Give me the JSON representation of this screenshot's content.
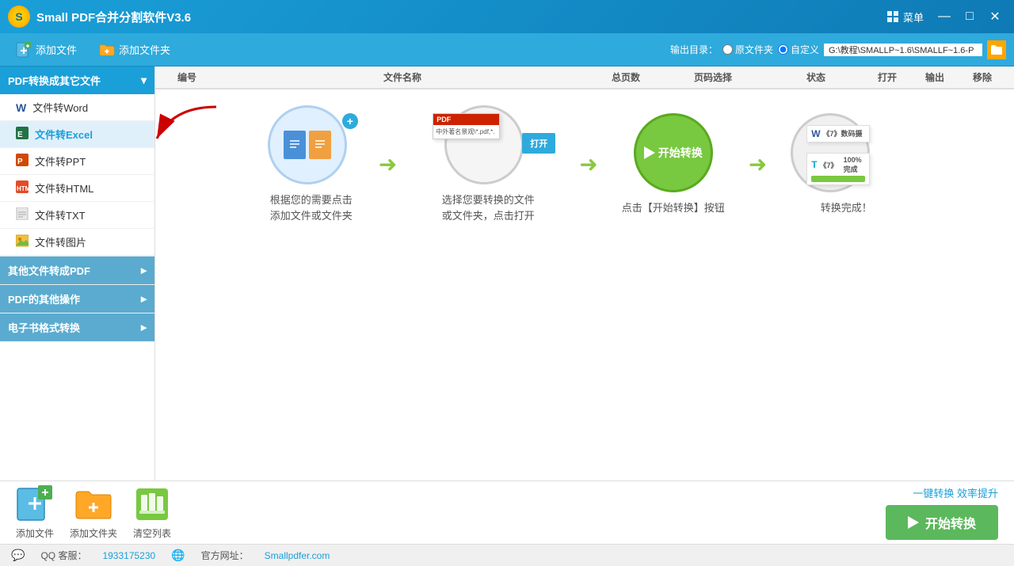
{
  "titleBar": {
    "logoText": "S",
    "title": "Small PDF合并分割软件V3.6",
    "menuLabel": "菜单"
  },
  "toolbar": {
    "addFile": "添加文件",
    "addFolder": "添加文件夹",
    "outputLabel": "输出目录：",
    "radioOriginal": "原文件夹",
    "radioCustom": "自定义",
    "outputPath": "G:\\教程\\SMALLP~1.6\\SMALLF~1.6-P"
  },
  "tableHeader": {
    "num": "编号",
    "name": "文件名称",
    "pages": "总页数",
    "pageSelect": "页码选择",
    "status": "状态",
    "open": "打开",
    "output": "输出",
    "remove": "移除"
  },
  "sidebar": {
    "sections": [
      {
        "id": "pdf-to-other",
        "label": "PDF转换成其它文件",
        "expanded": true,
        "items": [
          {
            "id": "to-word",
            "label": "文件转Word",
            "icon": "W",
            "active": false
          },
          {
            "id": "to-excel",
            "label": "文件转Excel",
            "icon": "📊",
            "active": true
          },
          {
            "id": "to-ppt",
            "label": "文件转PPT",
            "icon": "📋",
            "active": false
          },
          {
            "id": "to-html",
            "label": "文件转HTML",
            "icon": "🌐",
            "active": false
          },
          {
            "id": "to-txt",
            "label": "文件转TXT",
            "icon": "📄",
            "active": false
          },
          {
            "id": "to-image",
            "label": "文件转图片",
            "icon": "🖼",
            "active": false
          }
        ]
      },
      {
        "id": "other-to-pdf",
        "label": "其他文件转成PDF",
        "expanded": false,
        "items": []
      },
      {
        "id": "pdf-ops",
        "label": "PDF的其他操作",
        "expanded": false,
        "items": []
      },
      {
        "id": "ebook",
        "label": "电子书格式转换",
        "expanded": false,
        "items": []
      }
    ]
  },
  "instructions": {
    "step1": {
      "line1": "根据您的需要点击",
      "line2": "添加文件或文件夹"
    },
    "step2": {
      "line1": "选择您要转换的文件",
      "line2": "或文件夹，点击打开"
    },
    "step3": {
      "text": "点击【开始转换】按钮"
    },
    "step4": {
      "text": "转换完成！"
    },
    "startBtn": "开始转换",
    "percent": "100%  完成",
    "fileLabel1": "《7》数码摄",
    "fileLabel2": "《7》"
  },
  "bottomBar": {
    "addFile": "添加文件",
    "addFolder": "添加文件夹",
    "clearList": "清空列表",
    "efficiencyText": "一键转换 效率提升",
    "startConvert": "开始转换"
  },
  "supportBar": {
    "qqLabel": "QQ 客服：",
    "qqNumber": "1933175230",
    "websiteLabel": "官方网址：",
    "website": "Smallpdfer.com"
  }
}
